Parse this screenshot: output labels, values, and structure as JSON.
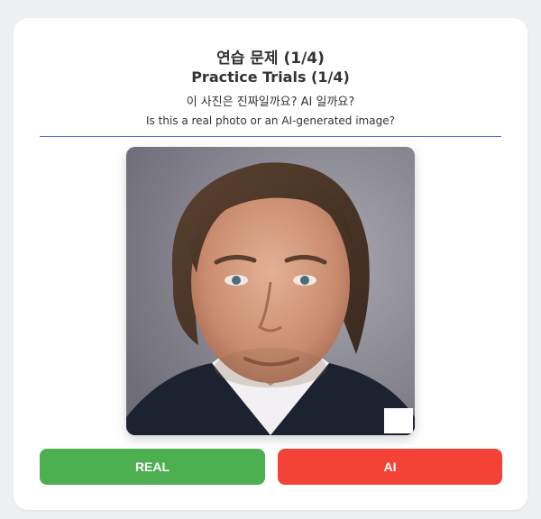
{
  "header": {
    "title_ko": "연습 문제 (1/4)",
    "title_en": "Practice Trials (1/4)",
    "question_ko": "이 사진은 진짜일까요? AI 일까요?",
    "question_en": "Is this a real photo or an AI-generated image?"
  },
  "buttons": {
    "real_label": "REAL",
    "ai_label": "AI"
  },
  "colors": {
    "real_button": "#4caf50",
    "ai_button": "#f44336",
    "divider": "#5a6fd6",
    "background": "#eef0f4",
    "card": "#ffffff"
  }
}
